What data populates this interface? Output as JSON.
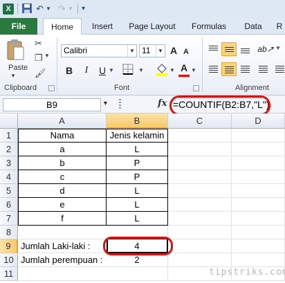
{
  "quick_access": {
    "icons": [
      "excel-icon",
      "save-icon",
      "undo-icon",
      "redo-icon",
      "customize-icon"
    ]
  },
  "tabs": {
    "file": "File",
    "items": [
      "Home",
      "Insert",
      "Page Layout",
      "Formulas",
      "Data",
      "R"
    ],
    "active": "Home"
  },
  "ribbon": {
    "clipboard": {
      "paste_label": "Paste",
      "group_label": "Clipboard"
    },
    "font": {
      "font_name": "Calibri",
      "font_size": "11",
      "bold": "B",
      "italic": "I",
      "underline": "U",
      "grow": "A",
      "shrink": "A",
      "font_color": "A",
      "group_label": "Font"
    },
    "alignment": {
      "group_label": "Alignment"
    }
  },
  "formula_bar": {
    "name_box": "B9",
    "fx": "fx",
    "formula": "=COUNTIF(B2:B7,\"L\")"
  },
  "sheet": {
    "columns": [
      "A",
      "B",
      "C",
      "D"
    ],
    "selected_column": "B",
    "selected_row": "9",
    "rows": [
      {
        "num": "1",
        "a": "Nama",
        "b": "Jenis kelamin"
      },
      {
        "num": "2",
        "a": "a",
        "b": "L"
      },
      {
        "num": "3",
        "a": "b",
        "b": "P"
      },
      {
        "num": "4",
        "a": "c",
        "b": "P"
      },
      {
        "num": "5",
        "a": "d",
        "b": "L"
      },
      {
        "num": "6",
        "a": "e",
        "b": "L"
      },
      {
        "num": "7",
        "a": "f",
        "b": "L"
      },
      {
        "num": "8",
        "a": "",
        "b": ""
      },
      {
        "num": "9",
        "a": "Jumlah Laki-laki :",
        "b": "4"
      },
      {
        "num": "10",
        "a": "Jumlah perempuan :",
        "b": "2"
      },
      {
        "num": "11",
        "a": "",
        "b": ""
      }
    ]
  },
  "watermark": "tipstriks.com",
  "colors": {
    "file_tab": "#2a7a3e",
    "highlight_ring": "#e01010",
    "selection": "#f7c96a"
  }
}
